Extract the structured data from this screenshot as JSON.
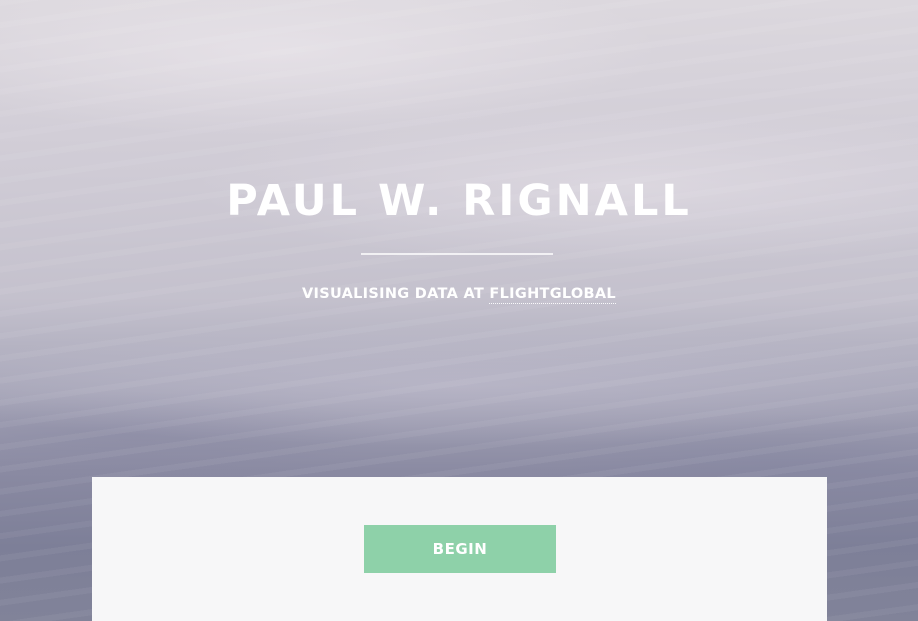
{
  "hero": {
    "title": "PAUL W. RIGNALL",
    "subtitle_prefix": "VISUALISING DATA AT",
    "subtitle_link": "FLIGHTGLOBAL"
  },
  "panel": {
    "begin_label": "BEGIN"
  },
  "colors": {
    "accent_button": "#8ed1a9",
    "panel_background": "#f7f7f8",
    "text": "#ffffff"
  }
}
